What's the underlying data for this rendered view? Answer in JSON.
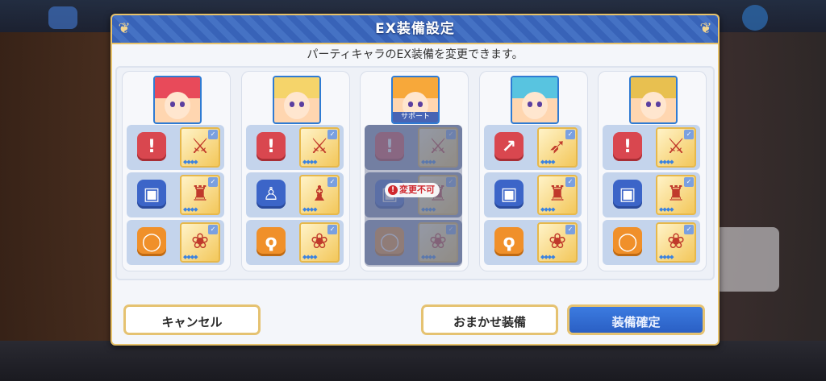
{
  "dialog": {
    "title": "EX装備設定",
    "subtitle": "パーティキャラのEX装備を変更できます。"
  },
  "characters": [
    {
      "support": false,
      "locked": false,
      "hair_color": "#e84a5a",
      "slots": [
        {
          "type": "weapon",
          "icon": "sword-icon",
          "equip": "sword-equipment-icon"
        },
        {
          "type": "armor",
          "icon": "armor-icon",
          "equip": "armor-equipment-icon"
        },
        {
          "type": "accessory",
          "icon": "ring-icon",
          "equip": "accessory-equipment-icon"
        }
      ]
    },
    {
      "support": false,
      "locked": false,
      "hair_color": "#f5d46a",
      "slots": [
        {
          "type": "weapon",
          "icon": "sword-icon",
          "equip": "sword-equipment-icon"
        },
        {
          "type": "armor",
          "icon": "shirt-icon",
          "equip": "robe-equipment-icon"
        },
        {
          "type": "accessory",
          "icon": "amulet-icon",
          "equip": "accessory-equipment-icon"
        }
      ]
    },
    {
      "support": true,
      "support_label": "サポート",
      "locked": true,
      "lock_label": "変更不可",
      "hair_color": "#f7a83a",
      "slots": [
        {
          "type": "weapon",
          "icon": "sword-icon",
          "equip": "sword-equipment-icon"
        },
        {
          "type": "armor",
          "icon": "armor-icon",
          "equip": "armor-equipment-icon"
        },
        {
          "type": "accessory",
          "icon": "ring-icon",
          "equip": "accessory-equipment-icon"
        }
      ]
    },
    {
      "support": false,
      "locked": false,
      "hair_color": "#58c4e0",
      "slots": [
        {
          "type": "weapon",
          "icon": "spear-icon",
          "equip": "spear-equipment-icon"
        },
        {
          "type": "armor",
          "icon": "armor-icon",
          "equip": "armor-equipment-icon"
        },
        {
          "type": "accessory",
          "icon": "amulet-icon",
          "equip": "accessory-equipment-icon"
        }
      ]
    },
    {
      "support": false,
      "locked": false,
      "hair_color": "#e8c050",
      "slots": [
        {
          "type": "weapon",
          "icon": "sword-icon",
          "equip": "sword-equipment-icon"
        },
        {
          "type": "armor",
          "icon": "armor-icon",
          "equip": "armor-equipment-icon"
        },
        {
          "type": "accessory",
          "icon": "ring-icon",
          "equip": "accessory-equipment-icon"
        }
      ]
    }
  ],
  "buttons": {
    "cancel": "キャンセル",
    "auto_equip": "おまかせ装備",
    "confirm": "装備確定"
  }
}
